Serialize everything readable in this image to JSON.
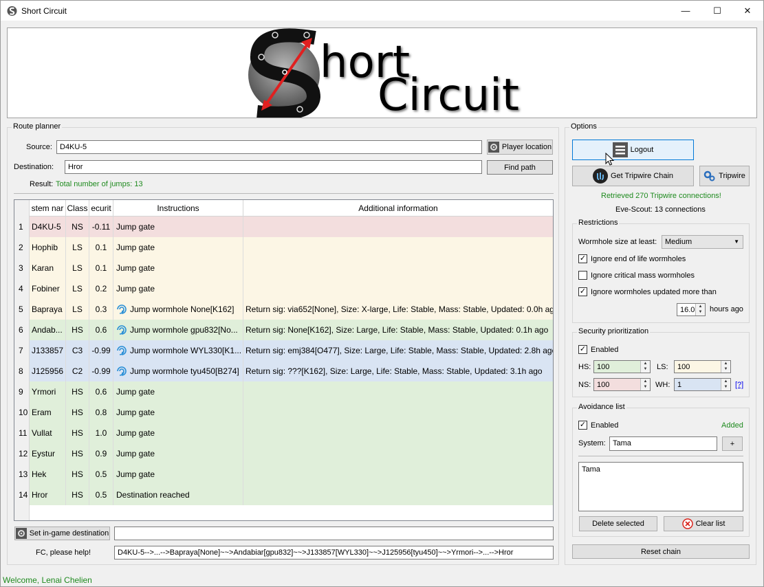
{
  "window": {
    "title": "Short Circuit",
    "minimize_glyph": "—",
    "maximize_glyph": "☐",
    "close_glyph": "✕"
  },
  "banner": {
    "logo_line1": "hort",
    "logo_line2": "Circuit"
  },
  "route_planner": {
    "title": "Route planner",
    "source_label": "Source:",
    "source_value": "D4KU-5",
    "destination_label": "Destination:",
    "destination_value": "Hror",
    "player_location_button": "Player location",
    "find_path_button": "Find path",
    "result_label": "Result:",
    "result_value": "Total number of jumps: 13",
    "columns": [
      "stem nar",
      "Class",
      "ecurit",
      "Instructions",
      "Additional information"
    ],
    "rows": [
      {
        "num": "1",
        "name": "D4KU-5",
        "class": "NS",
        "sec": "-0.11",
        "instr": "Jump gate",
        "info": "",
        "kind": "ns",
        "wh": false
      },
      {
        "num": "2",
        "name": "Hophib",
        "class": "LS",
        "sec": "0.1",
        "instr": "Jump gate",
        "info": "",
        "kind": "ls",
        "wh": false
      },
      {
        "num": "3",
        "name": "Karan",
        "class": "LS",
        "sec": "0.1",
        "instr": "Jump gate",
        "info": "",
        "kind": "ls",
        "wh": false
      },
      {
        "num": "4",
        "name": "Fobiner",
        "class": "LS",
        "sec": "0.2",
        "instr": "Jump gate",
        "info": "",
        "kind": "ls",
        "wh": false
      },
      {
        "num": "5",
        "name": "Bapraya",
        "class": "LS",
        "sec": "0.3",
        "instr": "Jump wormhole None[K162]",
        "info": "Return sig: via652[None], Size: X-large, Life: Stable, Mass: Stable, Updated: 0.0h ago",
        "kind": "ls",
        "wh": true
      },
      {
        "num": "6",
        "name": "Andab...",
        "class": "HS",
        "sec": "0.6",
        "instr": "Jump wormhole gpu832[No...",
        "info": "Return sig: None[K162], Size: Large, Life: Stable, Mass: Stable, Updated: 0.1h ago",
        "kind": "hs",
        "wh": true
      },
      {
        "num": "7",
        "name": "J133857",
        "class": "C3",
        "sec": "-0.99",
        "instr": "Jump wormhole WYL330[K1...",
        "info": "Return sig: emj384[O477], Size: Large, Life: Stable, Mass: Stable, Updated: 2.8h ago",
        "kind": "wh",
        "wh": true
      },
      {
        "num": "8",
        "name": "J125956",
        "class": "C2",
        "sec": "-0.99",
        "instr": "Jump wormhole tyu450[B274]",
        "info": "Return sig: ???[K162], Size: Large, Life: Stable, Mass: Stable, Updated: 3.1h ago",
        "kind": "wh",
        "wh": true
      },
      {
        "num": "9",
        "name": "Yrmori",
        "class": "HS",
        "sec": "0.6",
        "instr": "Jump gate",
        "info": "",
        "kind": "hs",
        "wh": false
      },
      {
        "num": "10",
        "name": "Eram",
        "class": "HS",
        "sec": "0.8",
        "instr": "Jump gate",
        "info": "",
        "kind": "hs",
        "wh": false
      },
      {
        "num": "11",
        "name": "Vullat",
        "class": "HS",
        "sec": "1.0",
        "instr": "Jump gate",
        "info": "",
        "kind": "hs",
        "wh": false
      },
      {
        "num": "12",
        "name": "Eystur",
        "class": "HS",
        "sec": "0.9",
        "instr": "Jump gate",
        "info": "",
        "kind": "hs",
        "wh": false
      },
      {
        "num": "13",
        "name": "Hek",
        "class": "HS",
        "sec": "0.5",
        "instr": "Jump gate",
        "info": "",
        "kind": "hs",
        "wh": false
      },
      {
        "num": "14",
        "name": "Hror",
        "class": "HS",
        "sec": "0.5",
        "instr": "Destination reached",
        "info": "",
        "kind": "hs",
        "wh": false
      }
    ],
    "set_destination_button": "Set in-game destination",
    "set_destination_field": "",
    "fc_label": "FC, please help!",
    "fc_value": "D4KU-5-->...-->Bapraya[None]~~>Andabiar[gpu832]~~>J133857[WYL330]~~>J125956[tyu450]~~>Yrmori-->...-->Hror"
  },
  "options": {
    "title": "Options",
    "logout_button": "Logout",
    "tripwire_chain_button": "Get Tripwire Chain",
    "tripwire_button": "Tripwire",
    "tripwire_status": "Retrieved 270 Tripwire connections!",
    "evescout_status": "Eve-Scout: 13 connections",
    "restrictions": {
      "title": "Restrictions",
      "wh_size_label": "Wormhole size at least:",
      "wh_size_value": "Medium",
      "ignore_eol": "Ignore end of life wormholes",
      "ignore_eol_checked": true,
      "ignore_crit": "Ignore critical mass wormholes",
      "ignore_crit_checked": false,
      "ignore_updated": "Ignore wormholes updated more than",
      "ignore_updated_checked": true,
      "hours_value": "16.0",
      "hours_label": "hours ago"
    },
    "security": {
      "title": "Security prioritization",
      "enabled_label": "Enabled",
      "enabled_checked": true,
      "hs_label": "HS:",
      "hs_value": "100",
      "ls_label": "LS:",
      "ls_value": "100",
      "ns_label": "NS:",
      "ns_value": "100",
      "wh_label": "WH:",
      "wh_value": "1",
      "help_link": "[?]"
    },
    "avoidance": {
      "title": "Avoidance list",
      "enabled_label": "Enabled",
      "enabled_checked": true,
      "added_label": "Added",
      "system_label": "System:",
      "system_value": "Tama",
      "add_button": "+",
      "list_items": [
        "Tama"
      ],
      "delete_button": "Delete selected",
      "clear_button": "Clear list"
    },
    "reset_chain_button": "Reset chain"
  },
  "statusbar": {
    "text": "Welcome, Lenai Chelien"
  },
  "colors": {
    "ns_row": "#f3dede",
    "ls_row": "#fcf6e5",
    "hs_row": "#e0efda",
    "wh_row": "#d9e4f3",
    "status_green": "#1e8a1e",
    "logout_accent": "#0078d7"
  },
  "icons": {
    "wormhole": "wormhole-swirl-icon",
    "gear": "gear-icon",
    "menu": "hamburger-icon",
    "tripwire": "tripwire-icon",
    "clear": "clear-x-icon"
  }
}
